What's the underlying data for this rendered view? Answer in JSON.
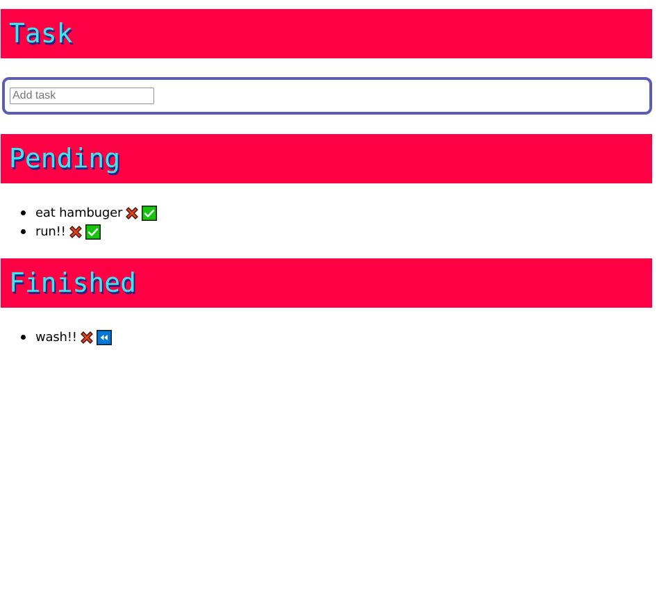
{
  "headers": {
    "task": "Task",
    "pending": "Pending",
    "finished": "Finished"
  },
  "form": {
    "placeholder": "Add task",
    "value": ""
  },
  "pending": [
    {
      "text": "eat hambuger",
      "delete_icon": "cross-mark-icon",
      "action_icon": "check-mark-icon"
    },
    {
      "text": "run!!",
      "delete_icon": "cross-mark-icon",
      "action_icon": "check-mark-icon"
    }
  ],
  "finished": [
    {
      "text": "wash!!",
      "delete_icon": "cross-mark-icon",
      "action_icon": "rewind-icon"
    }
  ],
  "colors": {
    "header_bg": "#ff0044",
    "header_text": "#3ee6ee",
    "header_shadow": "#0b2a8a",
    "form_border": "#5b5bbb",
    "check_bg": "#16c60c",
    "rewind_bg": "#0078d7",
    "cross": "#e0401a"
  }
}
